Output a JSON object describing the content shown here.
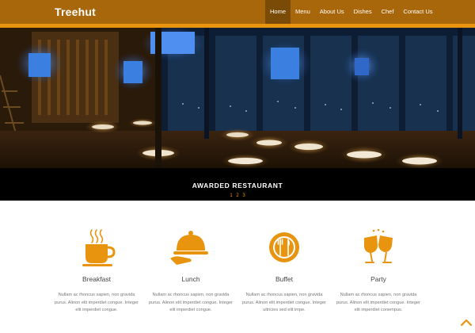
{
  "brand": "Treehut",
  "nav": [
    "Home",
    "Menu",
    "About Us",
    "Dishes",
    "Chef",
    "Contact Us"
  ],
  "hero": {
    "caption": "AWARDED RESTAURANT",
    "pager": [
      "1",
      "2",
      "3"
    ]
  },
  "services": [
    {
      "icon": "coffee-cup-icon",
      "title": "Breakfast",
      "text": "Nullam ac rhoncus sapien, non gravida purus. Alinon elit imperdiet congue. Integer elit imperdiet congue."
    },
    {
      "icon": "cloche-icon",
      "title": "Lunch",
      "text": "Nullam ac rhoncus sapien, non gravida purus. Alinon elit imperdiet congue. Integer elit imperdiet congue."
    },
    {
      "icon": "plate-cutlery-icon",
      "title": "Buffet",
      "text": "Nullam ac rhoncus sapien, non gravida purus. Alinon elit imperdiet congue. Integer ultricies sed elit impe."
    },
    {
      "icon": "wine-glasses-icon",
      "title": "Party",
      "text": "Nullam ac rhoncus sapien, non gravida purus. Alinon elit imperdiet congue. Integer elit imperdiet conempus."
    }
  ],
  "colors": {
    "header": "#a8670b",
    "accent": "#e8940f",
    "active_nav": "#7a4a07"
  }
}
